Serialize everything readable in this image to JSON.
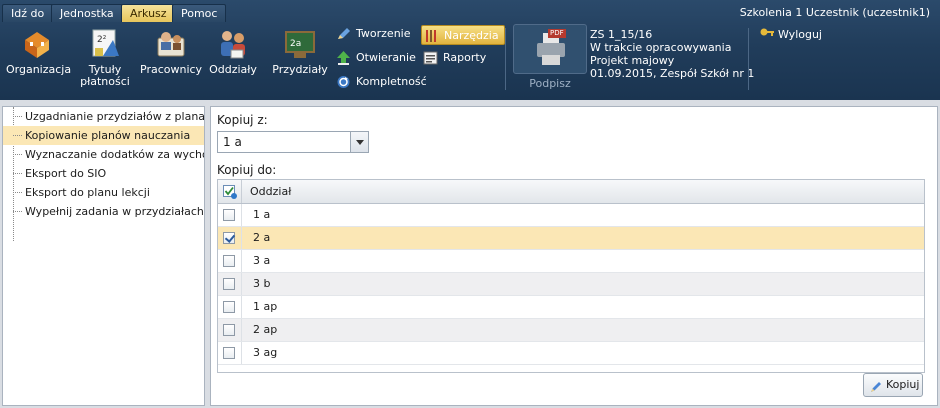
{
  "tabs": [
    "Idź do",
    "Jednostka",
    "Arkusz",
    "Pomoc"
  ],
  "active_tab": "Arkusz",
  "user_label": "Szkolenia 1 Uczestnik (uczestnik1)",
  "ribbon": {
    "organizacja": "Organizacja",
    "tytuly_line1": "Tytuły",
    "tytuly_line2": "płatności",
    "pracownicy": "Pracownicy",
    "oddzialy": "Oddziały",
    "przydzialy": "Przydziały",
    "tworzenie": "Tworzenie",
    "otwieranie": "Otwieranie",
    "kompletnosc": "Kompletność",
    "narzedzia": "Narzędzia",
    "raporty": "Raporty",
    "podpisz": "Podpisz",
    "pdf_badge": "PDF",
    "info_line1": "ZS 1_15/16",
    "info_line2": "W trakcie opracowywania",
    "info_line3": "Projekt majowy",
    "info_line4": "01.09.2015, Zespół Szkół nr 1",
    "wyloguj": "Wyloguj"
  },
  "tree_items": [
    "Uzgadnianie przydziałów z planami na",
    "Kopiowanie planów nauczania",
    "Wyznaczanie dodatków za wychowaw",
    "Eksport do SIO",
    "Eksport do planu lekcji",
    "Wypełnij zadania w przydziałach war"
  ],
  "selected_tree_index": 1,
  "form": {
    "copy_from_label": "Kopiuj z:",
    "copy_from_value": "1 a",
    "copy_to_label": "Kopiuj do:",
    "column_header": "Oddział",
    "rows": [
      {
        "name": "1 a",
        "checked": false
      },
      {
        "name": "2 a",
        "checked": true
      },
      {
        "name": "3 a",
        "checked": false
      },
      {
        "name": "3 b",
        "checked": false
      },
      {
        "name": "1 ap",
        "checked": false
      },
      {
        "name": "2 ap",
        "checked": false
      },
      {
        "name": "3 ag",
        "checked": false
      }
    ],
    "copy_button": "Kopiuj"
  },
  "colors": {
    "ribbon_bg": "#213d5b",
    "active_tab": "#e7c65c",
    "selection": "#fbe7b5",
    "highlight_button": "#e1b33f"
  },
  "icons": [
    "organizacja-icon",
    "tytuly-icon",
    "pracownicy-icon",
    "oddzialy-icon",
    "przydzialy-icon",
    "pencil-icon",
    "upload-icon",
    "refresh-icon",
    "tools-icon",
    "report-icon",
    "printer-icon",
    "key-icon"
  ]
}
